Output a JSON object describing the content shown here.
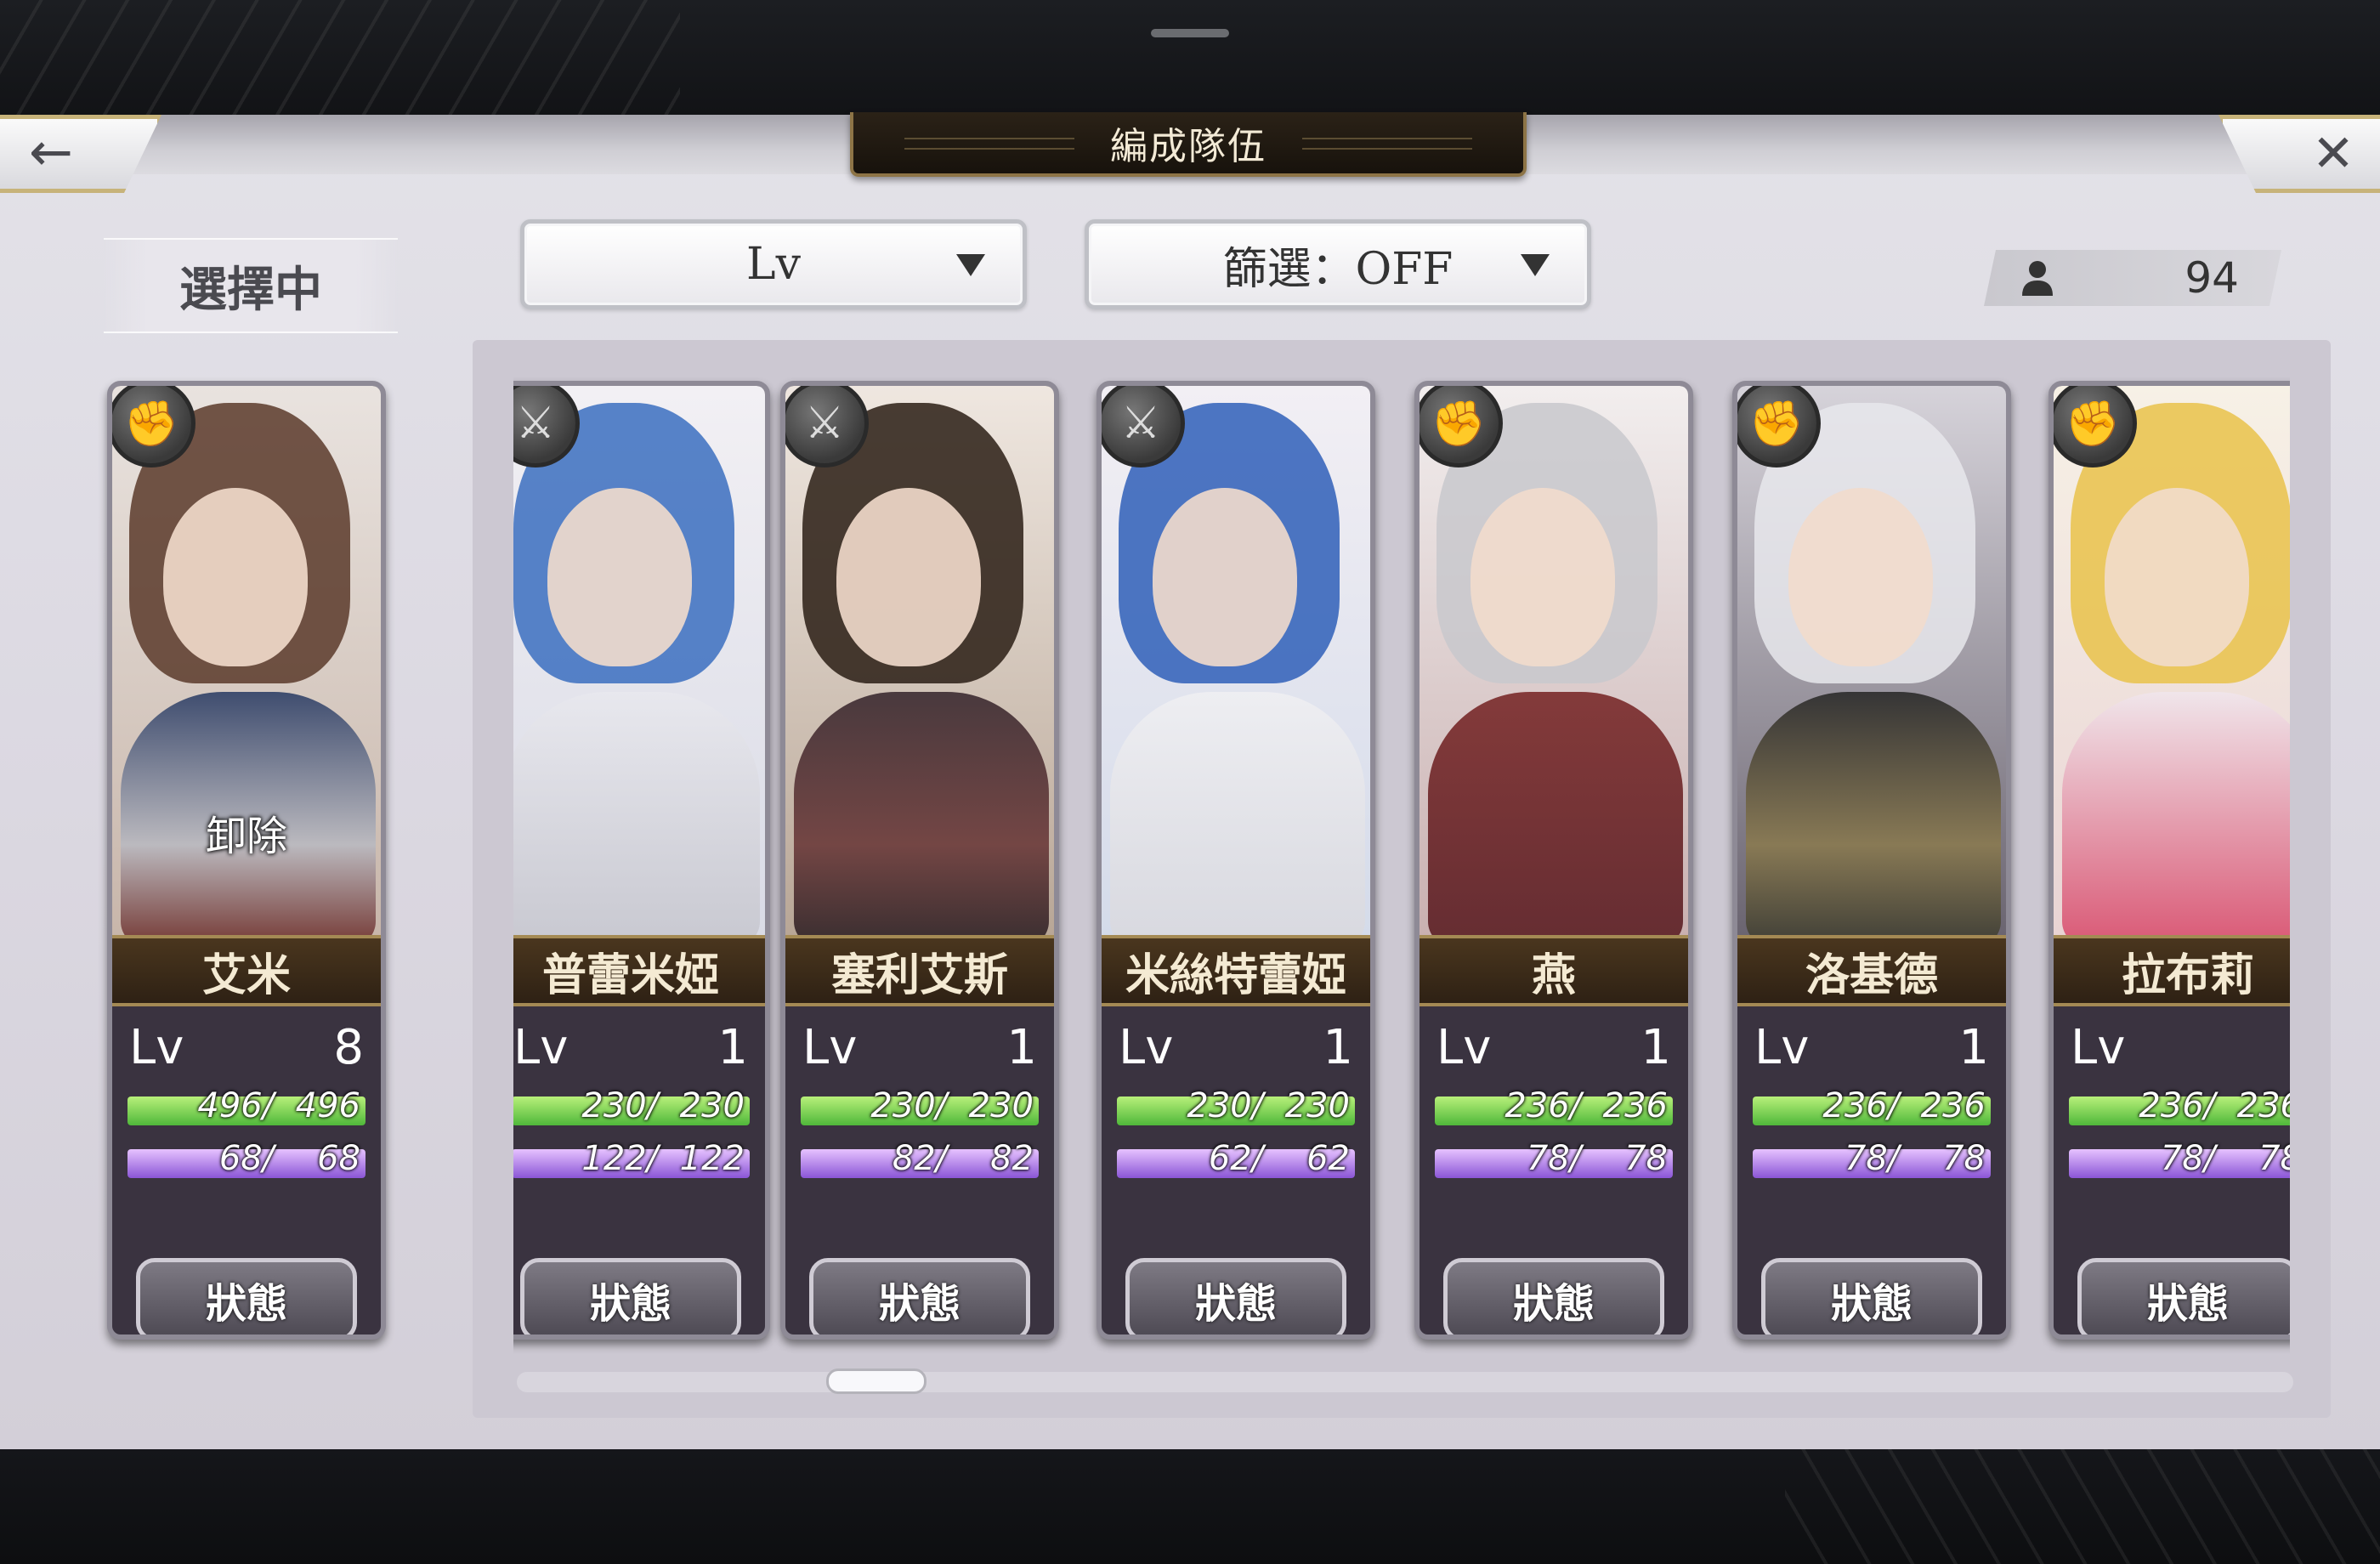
{
  "header": {
    "title": "編成隊伍"
  },
  "selecting_label": "選擇中",
  "sort_dropdown": {
    "value": "Lv"
  },
  "filter_dropdown": {
    "value": "篩選：OFF"
  },
  "unit_count": "94",
  "selected": {
    "name": "艾米",
    "lv_label": "Lv",
    "lv": "8",
    "hp": "496/  496",
    "mp": "68/    68",
    "remove_label": "卸除",
    "status_label": "狀態",
    "hp_fraction": 1.0,
    "mp_fraction": 1.0
  },
  "characters": [
    {
      "name": "普蕾米婭",
      "lv_label": "Lv",
      "lv": "1",
      "hp": "230/  230",
      "mp": "122/  122",
      "status_label": "狀態"
    },
    {
      "name": "塞利艾斯",
      "lv_label": "Lv",
      "lv": "1",
      "hp": "230/  230",
      "mp": "82/    82",
      "status_label": "狀態"
    },
    {
      "name": "米絲特蕾婭",
      "lv_label": "Lv",
      "lv": "1",
      "hp": "230/  230",
      "mp": "62/    62",
      "status_label": "狀態"
    },
    {
      "name": "燕",
      "lv_label": "Lv",
      "lv": "1",
      "hp": "236/  236",
      "mp": "78/    78",
      "status_label": "狀態"
    },
    {
      "name": "洛基德",
      "lv_label": "Lv",
      "lv": "1",
      "hp": "236/  236",
      "mp": "78/    78",
      "status_label": "狀態"
    },
    {
      "name": "拉布莉",
      "lv_label": "Lv",
      "lv": "",
      "hp": "236/  236",
      "mp": "78/    78",
      "status_label": "狀態"
    }
  ],
  "icons": {
    "back": "left-arrow-icon",
    "close": "close-icon",
    "unit": "person-icon",
    "class_fist": "fist-icon",
    "class_bow": "crossbow-icon"
  },
  "colors": {
    "hp_bar": "#4fb83a",
    "mp_bar": "#8a55d6",
    "name_plate": "#3a2a18",
    "title_plate": "#1d1711"
  }
}
